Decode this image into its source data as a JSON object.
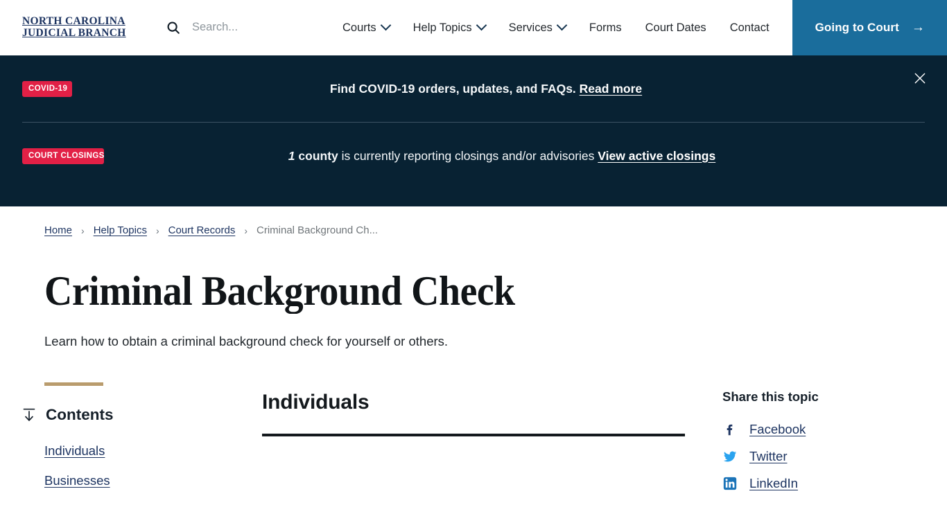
{
  "header": {
    "logo_line1": "NORTH CAROLINA",
    "logo_line2": "JUDICIAL BRANCH",
    "search_placeholder": "Search...",
    "search_value": "",
    "nav": [
      {
        "label": "Courts",
        "has_dropdown": true
      },
      {
        "label": "Help Topics",
        "has_dropdown": true
      },
      {
        "label": "Services",
        "has_dropdown": true
      },
      {
        "label": "Forms",
        "has_dropdown": false
      },
      {
        "label": "Court Dates",
        "has_dropdown": false
      },
      {
        "label": "Contact",
        "has_dropdown": false
      }
    ],
    "cta_label": "Going to Court",
    "cta_arrow": "→"
  },
  "alerts": {
    "close_label": "Close alerts",
    "covid": {
      "badge": "COVID-19",
      "text": "Find COVID-19 orders, updates, and FAQs.",
      "link": "Read more"
    },
    "closings": {
      "badge": "COURT CLOSINGS",
      "count": "1",
      "count_unit": "county",
      "text": "is currently reporting closings and/or advisories",
      "link": "View active closings"
    }
  },
  "breadcrumb": {
    "items": [
      {
        "label": "Home",
        "current": false
      },
      {
        "label": "Help Topics",
        "current": false
      },
      {
        "label": "Court Records",
        "current": false
      },
      {
        "label": "Criminal Background Ch...",
        "current": true
      }
    ],
    "separator": "›"
  },
  "page": {
    "title": "Criminal Background Check",
    "subtitle": "Learn how to obtain a criminal background check for yourself or others."
  },
  "contents": {
    "title": "Contents",
    "items": [
      {
        "label": "Individuals"
      },
      {
        "label": "Businesses"
      }
    ]
  },
  "main": {
    "section_title": "Individuals"
  },
  "share": {
    "title": "Share this topic",
    "items": [
      {
        "label": "Facebook",
        "icon": "facebook-icon",
        "color": "#1d3461"
      },
      {
        "label": "Twitter",
        "icon": "twitter-icon",
        "color": "#2aa3ef"
      },
      {
        "label": "LinkedIn",
        "icon": "linkedin-icon",
        "color": "#1c74b8"
      }
    ]
  },
  "colors": {
    "brand_navy": "#1d3461",
    "cta_blue": "#1a6d9c",
    "alert_bg": "#082233",
    "badge_red": "#e22046",
    "gold_rule": "#b99c6d"
  }
}
